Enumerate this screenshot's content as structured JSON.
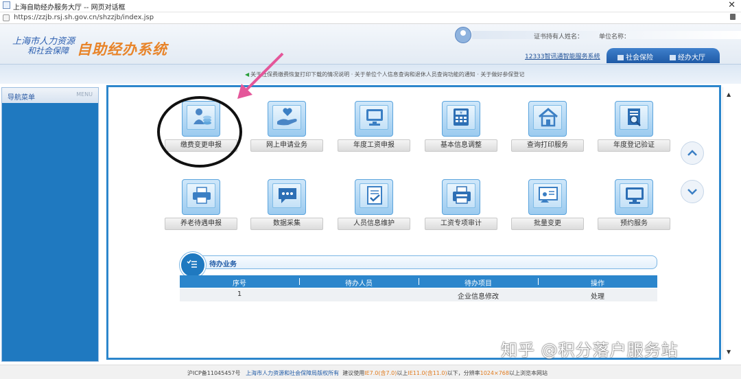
{
  "window": {
    "title": "上海自助经办服务大厅 -- 网页对话框",
    "close_glyph": "✕",
    "url": "https://zzjb.rsj.sh.gov.cn/shzzjb/index.jsp"
  },
  "header": {
    "logo_line1": "上海市人力资源",
    "logo_line2": "和社会保障",
    "logo_system": "自助经办系统",
    "holder_label": "证书持有人姓名：",
    "unit_label": "单位名称：",
    "smart_link": "12333智讯通智能服务系统",
    "tabs": [
      {
        "label": "社会保险"
      },
      {
        "label": "经办大厅"
      }
    ]
  },
  "notice": {
    "text": "关于社保费缴费恢复打印下载的情况说明 · 关于单位个人信息查询和退休人员查询功能的通知 · 关于做好参保登记"
  },
  "sidebar": {
    "title": "导航菜单",
    "menu_tag": "MENU"
  },
  "services": [
    {
      "label": "缴费变更申报",
      "icon": "payment-person-icon"
    },
    {
      "label": "网上申请业务",
      "icon": "hand-heart-icon"
    },
    {
      "label": "年度工资申报",
      "icon": "monitor-icon"
    },
    {
      "label": "基本信息调整",
      "icon": "yen-calculator-icon"
    },
    {
      "label": "查询打印服务",
      "icon": "house-icon"
    },
    {
      "label": "年度登记验证",
      "icon": "document-search-icon"
    },
    {
      "label": "养老待遇申报",
      "icon": "printer-icon"
    },
    {
      "label": "数据采集",
      "icon": "chat-bubble-icon"
    },
    {
      "label": "人员信息维护",
      "icon": "checklist-document-icon"
    },
    {
      "label": "工资专项审计",
      "icon": "fax-icon"
    },
    {
      "label": "批量变更",
      "icon": "presentation-icon"
    },
    {
      "label": "预约服务",
      "icon": "desktop-icon"
    }
  ],
  "todo": {
    "title": "待办业务",
    "columns": [
      "序号",
      "待办人员",
      "待办项目",
      "操作"
    ],
    "rows": [
      {
        "no": "1",
        "person": "",
        "item": "企业信息修改",
        "action": "处理"
      }
    ]
  },
  "watermark": "知乎 @积分落户服务站",
  "footer": {
    "icp": "沪ICP备11045457号",
    "copyright": "上海市人力资源和社会保障局版权所有",
    "advice1": "建议使用",
    "ie1": "IE7.0(含7.0)",
    "advice2": "以上",
    "ie2": "IE11.0(含11.0)",
    "advice3": "以下，分辨率",
    "res": "1024×768",
    "advice4": "以上浏览本网站"
  },
  "colors": {
    "primary_blue": "#2c86cc",
    "sidebar_blue": "#1f79c0",
    "logo_orange": "#e8842a",
    "annotation_pink": "#e4579a"
  }
}
